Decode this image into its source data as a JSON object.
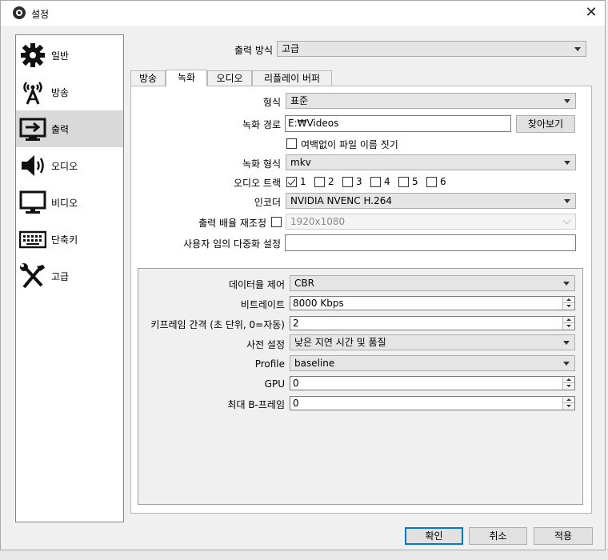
{
  "window": {
    "title": "설정",
    "close": "✕"
  },
  "sidebar": {
    "items": [
      {
        "label": "일반",
        "icon": "gear-icon"
      },
      {
        "label": "방송",
        "icon": "broadcast-icon"
      },
      {
        "label": "출력",
        "icon": "output-monitor-icon",
        "active": true
      },
      {
        "label": "오디오",
        "icon": "speaker-icon"
      },
      {
        "label": "비디오",
        "icon": "monitor-icon"
      },
      {
        "label": "단축키",
        "icon": "keyboard-icon"
      },
      {
        "label": "고급",
        "icon": "tools-icon"
      }
    ]
  },
  "output_mode": {
    "label": "출력 방식",
    "value": "고급"
  },
  "tabs": [
    {
      "label": "방송"
    },
    {
      "label": "녹화",
      "active": true
    },
    {
      "label": "오디오"
    },
    {
      "label": "리플레이 버퍼"
    }
  ],
  "recording": {
    "type_label": "형식",
    "type_value": "표준",
    "path_label": "녹화 경로",
    "path_value": "E:₩Videos",
    "browse_label": "찾아보기",
    "no_space_label": "여백없이 파일 이름 짓기",
    "format_label": "녹화 형식",
    "format_value": "mkv",
    "audio_track_label": "오디오 트랙",
    "audio_tracks": [
      {
        "label": "1",
        "checked": true
      },
      {
        "label": "2",
        "checked": false
      },
      {
        "label": "3",
        "checked": false
      },
      {
        "label": "4",
        "checked": false
      },
      {
        "label": "5",
        "checked": false
      },
      {
        "label": "6",
        "checked": false
      }
    ],
    "encoder_label": "인코더",
    "encoder_value": "NVIDIA NVENC H.264",
    "rescale_label": "출력 배율 재조정",
    "rescale_value": "1920x1080",
    "muxer_label": "사용자 임의 다중화 설정",
    "muxer_value": ""
  },
  "encoder_settings": {
    "rate_control_label": "데이터율 제어",
    "rate_control_value": "CBR",
    "bitrate_label": "비트레이트",
    "bitrate_value": "8000 Kbps",
    "keyframe_label": "키프레임 간격 (초 단위, 0=자동)",
    "keyframe_value": "2",
    "preset_label": "사전 설정",
    "preset_value": "낮은 지연 시간 및 품질",
    "profile_label": "Profile",
    "profile_value": "baseline",
    "gpu_label": "GPU",
    "gpu_value": "0",
    "bframes_label": "최대 B-프레임",
    "bframes_value": "0"
  },
  "buttons": {
    "ok": "확인",
    "cancel": "취소",
    "apply": "적용"
  },
  "colors": {
    "selected": "#d9d9d9",
    "default_button_border": "#0078d7"
  }
}
